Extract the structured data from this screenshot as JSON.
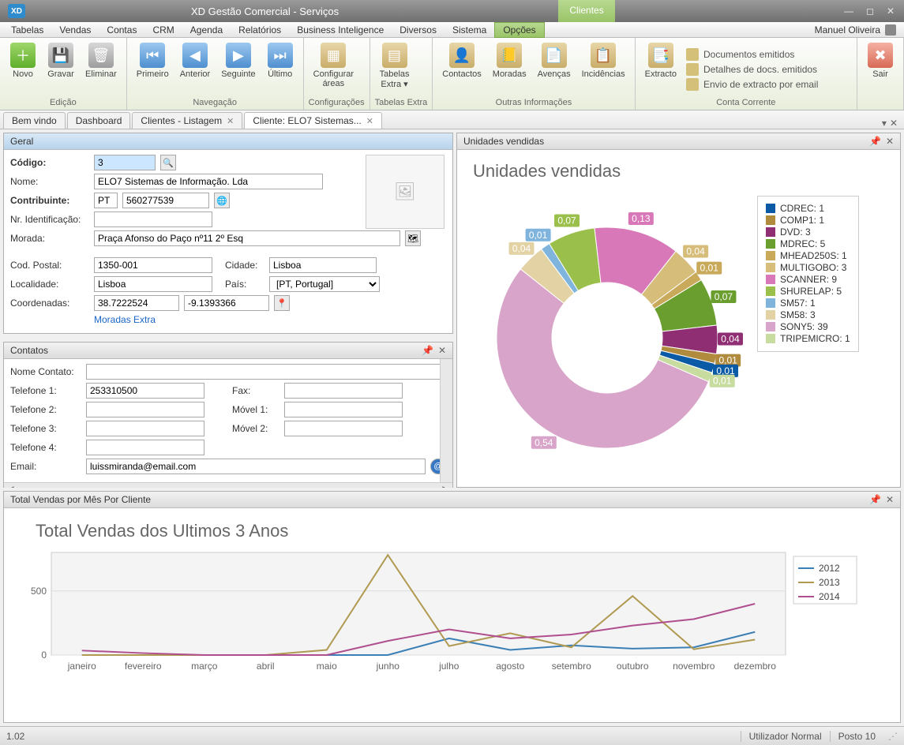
{
  "window": {
    "title": "XD Gestão Comercial - Serviços"
  },
  "topTab": {
    "clientes": "Clientes"
  },
  "menu": {
    "items": [
      "Tabelas",
      "Vendas",
      "Contas",
      "CRM",
      "Agenda",
      "Relatórios",
      "Business Inteligence",
      "Diversos",
      "Sistema",
      "Opções"
    ],
    "user": "Manuel Oliveira"
  },
  "ribbon": {
    "edicao": {
      "label": "Edição",
      "novo": "Novo",
      "gravar": "Gravar",
      "eliminar": "Eliminar"
    },
    "navegacao": {
      "label": "Navegação",
      "primeiro": "Primeiro",
      "anterior": "Anterior",
      "seguinte": "Seguinte",
      "ultimo": "Último"
    },
    "config": {
      "label": "Configurações",
      "configurar": "Configurar",
      "areas": "áreas"
    },
    "tabelasExtra": {
      "label": "Tabelas Extra",
      "tabelas": "Tabelas",
      "extra": "Extra ▾"
    },
    "outras": {
      "label": "Outras Informações",
      "contactos": "Contactos",
      "moradas": "Moradas",
      "avencas": "Avenças",
      "incidencias": "Incidências"
    },
    "conta": {
      "label": "Conta Corrente",
      "extracto": "Extracto",
      "docEmit": "Documentos emitidos",
      "detDoc": "Detalhes de docs. emitidos",
      "envio": "Envio de extracto por email"
    },
    "sair": "Sair"
  },
  "tabs": {
    "bemvindo": "Bem vindo",
    "dashboard": "Dashboard",
    "listagem": "Clientes - Listagem",
    "cliente": "Cliente: ELO7 Sistemas..."
  },
  "geral": {
    "header": "Geral",
    "codigoLbl": "Código:",
    "codigo": "3",
    "nomeLbl": "Nome:",
    "nome": "ELO7 Sistemas de Informação. Lda",
    "contribLbl": "Contribuinte:",
    "contribPrefix": "PT",
    "contrib": "560277539",
    "nridLbl": "Nr. Identificação:",
    "nrid": "",
    "moradaLbl": "Morada:",
    "morada": "Praça Afonso do Paço nº11 2º Esq",
    "cpLbl": "Cod. Postal:",
    "cp": "1350-001",
    "cidadeLbl": "Cidade:",
    "cidade": "Lisboa",
    "localLbl": "Localidade:",
    "local": "Lisboa",
    "paisLbl": "País:",
    "pais": "[PT, Portugal]",
    "coordLbl": "Coordenadas:",
    "lat": "38.7222524",
    "lon": "-9.1393366",
    "moradasExtra": "Moradas Extra"
  },
  "contatos": {
    "header": "Contatos",
    "nomeContatoLbl": "Nome Contato:",
    "nomeContato": "",
    "tel1Lbl": "Telefone 1:",
    "tel1": "253310500",
    "faxLbl": "Fax:",
    "fax": "",
    "tel2Lbl": "Telefone 2:",
    "tel2": "",
    "mov1Lbl": "Móvel 1:",
    "mov1": "",
    "tel3Lbl": "Telefone 3:",
    "tel3": "",
    "mov2Lbl": "Móvel 2:",
    "mov2": "",
    "tel4Lbl": "Telefone 4:",
    "tel4": "",
    "emailLbl": "Email:",
    "email": "luissmiranda@email.com"
  },
  "unidades": {
    "header": "Unidades vendidas",
    "title": "Unidades vendidas"
  },
  "totalvendas": {
    "header": "Total Vendas por Mês Por Cliente",
    "title": "Total Vendas dos Ultimos 3 Anos"
  },
  "status": {
    "version": "1.02",
    "user": "Utilizador Normal",
    "posto": "Posto 10"
  },
  "chart_data": [
    {
      "type": "pie",
      "title": "Unidades vendidas",
      "series": [
        {
          "name": "CDREC",
          "value": 1,
          "color": "#0b5aa5",
          "labelFrac": "0,01"
        },
        {
          "name": "COMP1",
          "value": 1,
          "color": "#b08b3e",
          "labelFrac": "0,01"
        },
        {
          "name": "DVD",
          "value": 3,
          "color": "#8f2e72",
          "labelFrac": "0,04"
        },
        {
          "name": "MDREC",
          "value": 5,
          "color": "#6a9e2e",
          "labelFrac": "0,07"
        },
        {
          "name": "MHEAD250S",
          "value": 1,
          "color": "#c9a95a",
          "labelFrac": "0,01"
        },
        {
          "name": "MULTIGOBO",
          "value": 3,
          "color": "#d6bd7a",
          "labelFrac": "0,04"
        },
        {
          "name": "SCANNER",
          "value": 9,
          "color": "#d978b8",
          "labelFrac": "0,13"
        },
        {
          "name": "SHURELAP",
          "value": 5,
          "color": "#9abf4a",
          "labelFrac": "0,07"
        },
        {
          "name": "SM57",
          "value": 1,
          "color": "#7fb4dd",
          "labelFrac": "0,01"
        },
        {
          "name": "SM58",
          "value": 3,
          "color": "#e3d3a4",
          "labelFrac": "0,04"
        },
        {
          "name": "SONY5",
          "value": 39,
          "color": "#d8a4c9",
          "labelFrac": "0,54"
        },
        {
          "name": "TRIPEMICRO",
          "value": 1,
          "color": "#c8dca0",
          "labelFrac": "0,01"
        }
      ]
    },
    {
      "type": "line",
      "title": "Total Vendas dos Ultimos 3 Anos",
      "categories": [
        "janeiro",
        "fevereiro",
        "março",
        "abril",
        "maio",
        "junho",
        "julho",
        "agosto",
        "setembro",
        "outubro",
        "novembro",
        "dezembro"
      ],
      "ylim": [
        0,
        800
      ],
      "yTicks": [
        0,
        500
      ],
      "series": [
        {
          "name": "2012",
          "color": "#3b7fb5",
          "values": [
            0,
            0,
            0,
            0,
            0,
            0,
            130,
            40,
            75,
            50,
            60,
            180
          ]
        },
        {
          "name": "2013",
          "color": "#b09a52",
          "values": [
            0,
            0,
            0,
            0,
            40,
            780,
            70,
            170,
            60,
            460,
            45,
            120
          ]
        },
        {
          "name": "2014",
          "color": "#b04f8f",
          "values": [
            35,
            15,
            0,
            0,
            0,
            110,
            200,
            130,
            160,
            230,
            280,
            400
          ]
        }
      ],
      "legendPos": "right"
    }
  ]
}
